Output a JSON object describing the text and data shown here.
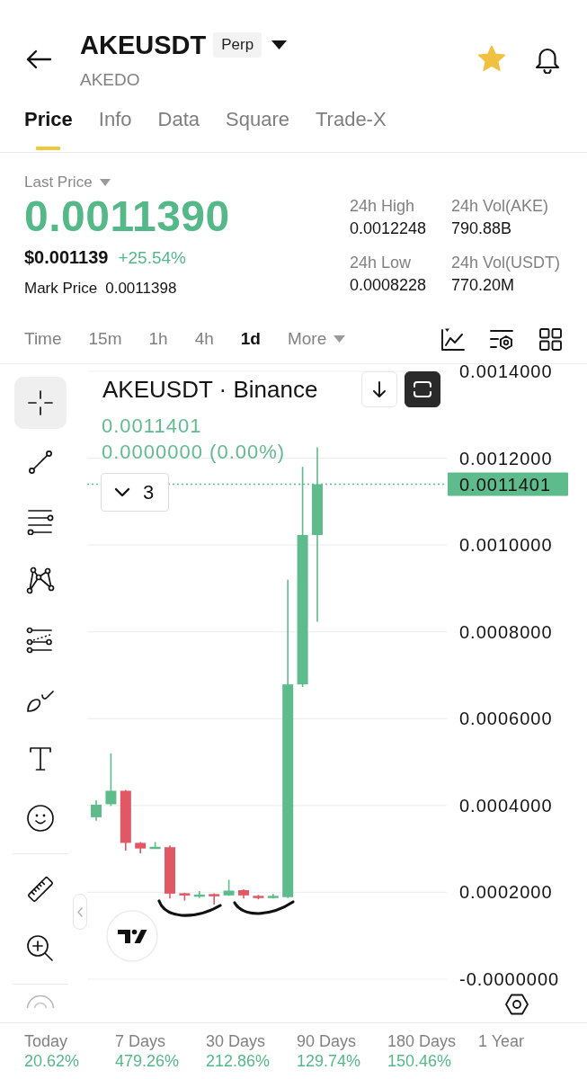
{
  "header": {
    "title": "AKEUSDT",
    "badge": "Perp",
    "subtitle": "AKEDO",
    "favorite": true
  },
  "tabs": [
    {
      "label": "Price",
      "selected": true
    },
    {
      "label": "Info",
      "selected": false
    },
    {
      "label": "Data",
      "selected": false
    },
    {
      "label": "Square",
      "selected": false
    },
    {
      "label": "Trade-X",
      "selected": false
    }
  ],
  "price": {
    "label": "Last Price",
    "last_price": "0.0011390",
    "usd_price": "$0.001139",
    "change": "+25.54%",
    "mark_price_label": "Mark Price",
    "mark_price": "0.0011398"
  },
  "stats": [
    {
      "label": "24h High",
      "value": "0.0012248"
    },
    {
      "label": "24h Vol(AKE)",
      "value": "790.88B"
    },
    {
      "label": "24h Low",
      "value": "0.0008228"
    },
    {
      "label": "24h Vol(USDT)",
      "value": "770.20M"
    }
  ],
  "intervals": [
    {
      "label": "Time",
      "kind": "interval",
      "selected": false
    },
    {
      "label": "15m",
      "kind": "interval",
      "selected": false
    },
    {
      "label": "1h",
      "kind": "interval",
      "selected": false
    },
    {
      "label": "4h",
      "kind": "interval",
      "selected": false
    },
    {
      "label": "1d",
      "kind": "interval",
      "selected": true
    },
    {
      "label": "More",
      "kind": "menu",
      "selected": false
    }
  ],
  "drawing_tools": [
    {
      "tools": [
        {
          "kind": "crosshair",
          "selected": true
        },
        {
          "kind": "trend_line",
          "selected": false
        },
        {
          "kind": "lines",
          "selected": false
        },
        {
          "kind": "pattern",
          "selected": false
        },
        {
          "kind": "fib",
          "selected": false
        },
        {
          "kind": "brush",
          "selected": false
        },
        {
          "kind": "text",
          "selected": false
        },
        {
          "kind": "emoji",
          "selected": false
        }
      ]
    },
    {
      "tools": [
        {
          "kind": "ruler",
          "selected": false
        },
        {
          "kind": "zoom",
          "selected": false
        }
      ]
    },
    {
      "tools": [
        {
          "kind": "cut_off",
          "selected": false
        }
      ]
    }
  ],
  "chart": {
    "title": "AKEUSDT · Binance",
    "price": "0.0011401",
    "change": "0.0000000 (0.00%)",
    "indicator_count": "3",
    "price_tag": "0.0011401",
    "axis_labels": [
      "0.0014000",
      "0.0012000",
      "0.0010000",
      "0.0008000",
      "0.0006000",
      "0.0004000",
      "0.0002000",
      "-0.0000000"
    ]
  },
  "performance": [
    {
      "label": "Today",
      "value": "20.62%"
    },
    {
      "label": "7 Days",
      "value": "479.26%"
    },
    {
      "label": "30 Days",
      "value": "212.86%"
    },
    {
      "label": "90 Days",
      "value": "129.74%"
    },
    {
      "label": "180 Days",
      "value": "150.46%"
    },
    {
      "label": "1 Year"
    }
  ]
}
